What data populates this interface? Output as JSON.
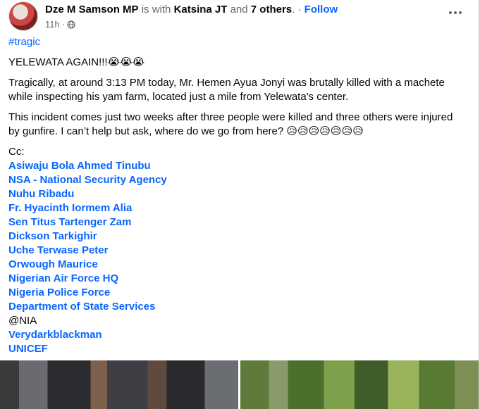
{
  "header": {
    "author": "Dze M Samson MP",
    "is_with": "is with",
    "tagged": "Katsina JT",
    "and": "and",
    "others": "7 others",
    "dot_sep": ". ·",
    "follow": "Follow",
    "time": "11h",
    "time_sep": "·",
    "privacy_icon": "globe-icon",
    "more_icon": "more-options-icon"
  },
  "post": {
    "hashtag": "#tragic",
    "headline": "YELEWATA AGAIN!!!😭😭😭",
    "paragraph1": "Tragically, at around 3:13 PM today, Mr. Hemen Ayua Jonyi was brutally killed with a machete while inspecting his yam farm, located just a mile from Yelewata's center.",
    "paragraph2": "This incident comes just two weeks after three people were killed and three others were injured by gunfire. I can’t help but ask, where do we go from here? 😥😥😥😥😥😥😥",
    "cc_label": "Cc:",
    "mentions": [
      "Asiwaju Bola Ahmed Tinubu",
      "NSA - National Security Agency",
      "Nuhu Ribadu",
      "Fr. Hyacinth Iormem Alia",
      "Sen Titus Tartenger Zam",
      "Dickson Tarkighir",
      "Uche Terwase Peter",
      "Orwough Maurice",
      "Nigerian Air Force HQ",
      "Nigeria Police Force",
      "Department of State Services"
    ],
    "plain_mention": "@NIA",
    "mentions_after": [
      "Verydarkblackman",
      "UNICEF"
    ]
  },
  "colors": {
    "link": "#0866ff",
    "muted": "#65676b",
    "text": "#050505"
  }
}
